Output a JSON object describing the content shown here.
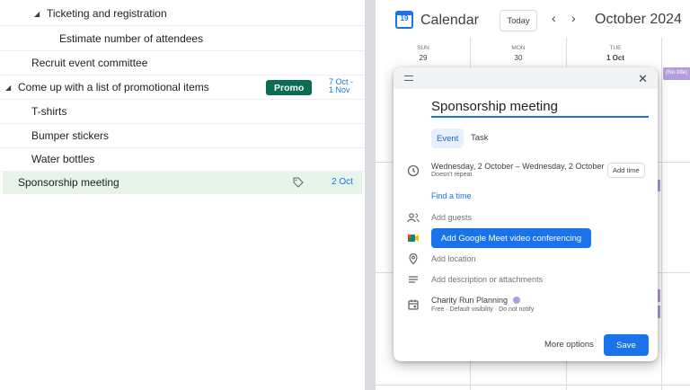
{
  "tasks": {
    "rows": [
      {
        "label": "Ticketing and registration",
        "caret": "◢"
      },
      {
        "label": "Estimate number of attendees"
      },
      {
        "label": "Recruit event committee"
      },
      {
        "label": "Come up with a list of promotional items",
        "caret": "◢",
        "tag": "Promo",
        "date_line1": "7 Oct -",
        "date_line2": "1 Nov"
      },
      {
        "label": "T-shirts"
      },
      {
        "label": "Bumper stickers"
      },
      {
        "label": "Water bottles"
      },
      {
        "label": "Sponsorship meeting",
        "date": "2 Oct",
        "icon": "tag-icon"
      }
    ]
  },
  "calendar": {
    "app_title": "Calendar",
    "logo_number": "19",
    "today_label": "Today",
    "prev_icon": "‹",
    "next_icon": "›",
    "month_label": "October 2024",
    "days": [
      {
        "name": "SUN",
        "date": "29"
      },
      {
        "name": "MON",
        "date": "30"
      },
      {
        "name": "TUE",
        "date": "1 Oct"
      }
    ],
    "no_title_chip": "(No title)"
  },
  "dialog": {
    "title_value": "Sponsorship meeting",
    "tab_event": "Event",
    "tab_task": "Task",
    "datetime": "Wednesday, 2 October  –  Wednesday, 2 October",
    "repeat": "Doesn't repeat",
    "add_time": "Add time",
    "find_time": "Find a time",
    "add_guests": "Add guests",
    "meet_button": "Add Google Meet video conferencing",
    "add_location": "Add location",
    "add_description": "Add description or attachments",
    "calendar_name": "Charity Run Planning",
    "calendar_sub": "Free · Default visibility · Do not notify",
    "more_options": "More options",
    "save": "Save",
    "close_icon": "✕"
  },
  "colors": {
    "accent": "#1a73e8",
    "tag_green": "#0b6b53",
    "selected_row": "#e6f4ea",
    "calendar_dot": "#b39ddb"
  }
}
